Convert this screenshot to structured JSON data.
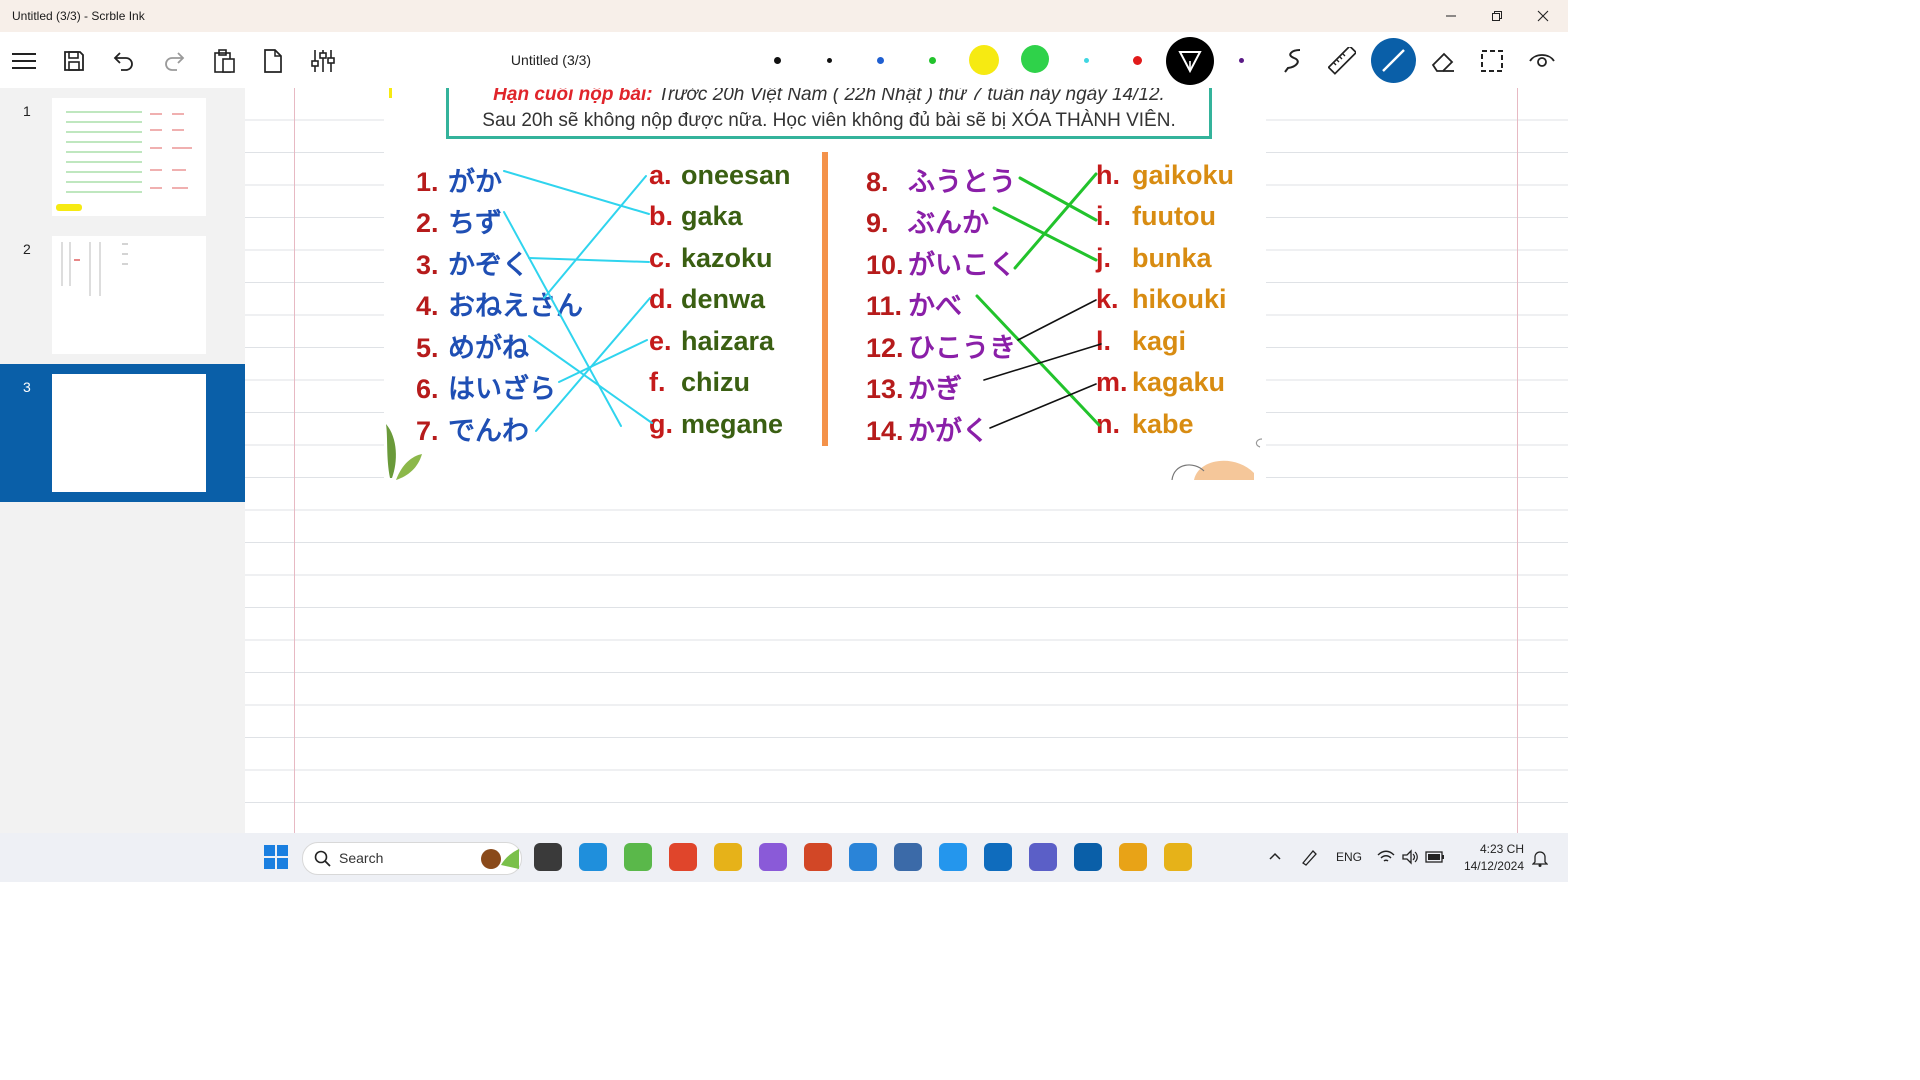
{
  "window": {
    "title": "Untitled (3/3) - Scrble Ink"
  },
  "toolbar": {
    "doc_title": "Untitled (3/3)"
  },
  "pen_colors": [
    "#111111",
    "#111111",
    "#1f5fd1",
    "#22c32c",
    "#f6ea12",
    "#2fd24a",
    "#3fd6e2",
    "#e11a1a",
    "#000000",
    "#5a1a86"
  ],
  "sidebar": {
    "pages": [
      {
        "num": "1"
      },
      {
        "num": "2"
      },
      {
        "num": "3"
      }
    ]
  },
  "notice": {
    "line1_label": "Hạn cuối nộp bài:",
    "line1_text": " Trước 20h Việt Nam ( 22h Nhật ) thứ 7 tuần này ngày 14/12.",
    "line2": "Sau 20h sẽ không nộp được nữa. Học viên không đủ bài sẽ bị XÓA THÀNH VIÊN."
  },
  "exercise": {
    "left_words": [
      {
        "num": "1.",
        "jp": "がか"
      },
      {
        "num": "2.",
        "jp": "ちず"
      },
      {
        "num": "3.",
        "jp": "かぞく"
      },
      {
        "num": "4.",
        "jp": "おねえさん"
      },
      {
        "num": "5.",
        "jp": "めがね"
      },
      {
        "num": "6.",
        "jp": "はいざら"
      },
      {
        "num": "7.",
        "jp": "でんわ"
      }
    ],
    "left_answers": [
      {
        "letter": "a.",
        "romaji": "oneesan"
      },
      {
        "letter": "b.",
        "romaji": "gaka"
      },
      {
        "letter": "c.",
        "romaji": "kazoku"
      },
      {
        "letter": "d.",
        "romaji": "denwa"
      },
      {
        "letter": "e.",
        "romaji": "haizara"
      },
      {
        "letter": "f.",
        "romaji": "chizu"
      },
      {
        "letter": "g.",
        "romaji": "megane"
      }
    ],
    "right_words": [
      {
        "num": "8.",
        "jp": "ふうとう"
      },
      {
        "num": "9.",
        "jp": "ぶんか"
      },
      {
        "num": "10.",
        "jp": "がいこく"
      },
      {
        "num": "11.",
        "jp": "かべ"
      },
      {
        "num": "12.",
        "jp": "ひこうき"
      },
      {
        "num": "13.",
        "jp": "かぎ"
      },
      {
        "num": "14.",
        "jp": "かがく"
      }
    ],
    "right_answers": [
      {
        "letter": "h.",
        "romaji": "gaikoku"
      },
      {
        "letter": "i.",
        "romaji": "fuutou"
      },
      {
        "letter": "j.",
        "romaji": "bunka"
      },
      {
        "letter": "k.",
        "romaji": "hikouki"
      },
      {
        "letter": "l.",
        "romaji": "kagi"
      },
      {
        "letter": "m.",
        "romaji": "kagaku"
      },
      {
        "letter": "n.",
        "romaji": "kabe"
      }
    ]
  },
  "ink_colors": {
    "cyan": "#2fd4ee",
    "green": "#22c32c",
    "black": "#111111"
  },
  "taskbar": {
    "search_label": "Search",
    "apps": [
      "explorer-icon",
      "edge-icon",
      "coccoc-icon",
      "brave-icon",
      "chrome-icon",
      "copilot-icon",
      "powerpoint-icon",
      "vscode-icon",
      "sql-icon",
      "docker-icon",
      "outlook-icon",
      "teams-icon",
      "scrble-ink-icon",
      "photos-icon",
      "chrome-icon"
    ],
    "lang": "ENG",
    "time": "4:23 CH",
    "date": "14/12/2024"
  }
}
